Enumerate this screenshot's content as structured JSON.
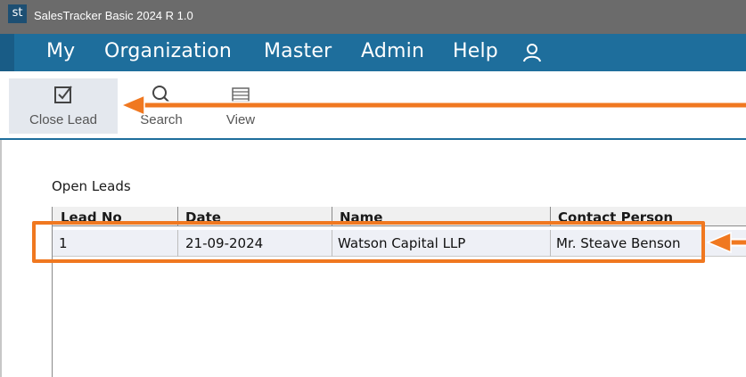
{
  "window": {
    "logo_text": "st",
    "title": "SalesTracker Basic 2024 R 1.0"
  },
  "menu": {
    "items": [
      "My",
      "Organization",
      "Master",
      "Admin",
      "Help"
    ],
    "user_icon": "user-icon"
  },
  "toolbar": {
    "buttons": [
      {
        "label": "Close Lead",
        "icon": "checkbox-icon",
        "active": true
      },
      {
        "label": "Search",
        "icon": "search-icon",
        "active": false
      },
      {
        "label": "View",
        "icon": "view-icon",
        "active": false
      }
    ]
  },
  "main": {
    "section_title": "Open Leads",
    "table": {
      "columns": [
        "Lead No",
        "Date",
        "Name",
        "Contact Person"
      ],
      "rows": [
        [
          "1",
          "21-09-2024",
          "Watson Capital LLP",
          "Mr. Steave Benson"
        ]
      ]
    }
  },
  "colors": {
    "menu_bar": "#1e6e9c",
    "title_bar": "#6b6b6b",
    "annotation": "#f07820"
  }
}
